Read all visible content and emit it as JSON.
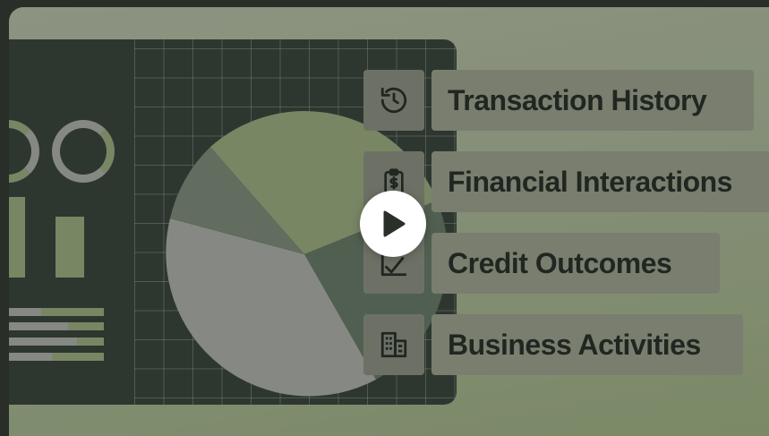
{
  "menu": {
    "items": [
      {
        "label": "Transaction History",
        "icon": "history-icon"
      },
      {
        "label": "Financial Interactions",
        "icon": "clipboard-dollar-icon"
      },
      {
        "label": "Credit Outcomes",
        "icon": "chart-check-icon"
      },
      {
        "label": "Business Activities",
        "icon": "building-icon"
      }
    ]
  },
  "video": {
    "control": "play-icon"
  },
  "colors": {
    "panel": "#2f3a33",
    "accent_green": "#8c9a72",
    "neutral_gray": "#9a9d98",
    "label_bg": "#8c917f",
    "text_dark": "#1f2620"
  }
}
